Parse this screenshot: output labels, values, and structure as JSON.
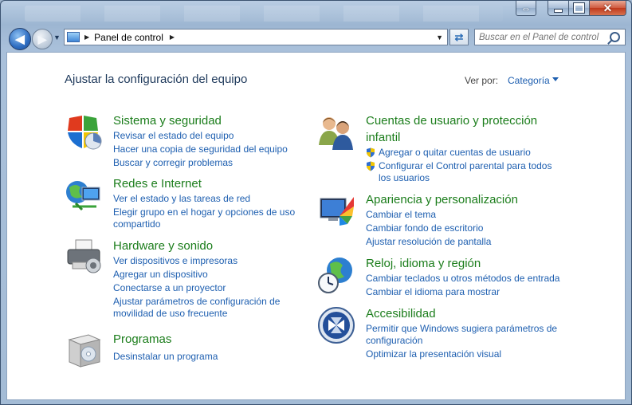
{
  "window": {
    "caption_resize": "⇔",
    "caption_close": "✕"
  },
  "toolbar": {
    "address": "Panel de control",
    "search_placeholder": "Buscar en el Panel de control"
  },
  "content": {
    "title": "Ajustar la configuración del equipo",
    "view_by_label": "Ver por:",
    "view_by_value": "Categoría"
  },
  "categories": {
    "system": {
      "title": "Sistema y seguridad",
      "links": [
        "Revisar el estado del equipo",
        "Hacer una copia de seguridad del equipo",
        "Buscar y corregir problemas"
      ]
    },
    "network": {
      "title": "Redes e Internet",
      "links": [
        "Ver el estado y las tareas de red",
        "Elegir grupo en el hogar y opciones de uso",
        "compartido"
      ]
    },
    "hardware": {
      "title": "Hardware y sonido",
      "links": [
        "Ver dispositivos e impresoras",
        "Agregar un dispositivo",
        "Conectarse a un proyector",
        "Ajustar parámetros de configuración de",
        "movilidad de uso frecuente"
      ]
    },
    "programs": {
      "title": "Programas",
      "links": [
        "Desinstalar un programa"
      ]
    },
    "accounts": {
      "title_line1": "Cuentas de usuario y protección",
      "title_line2": "infantil",
      "links": [
        "Agregar o quitar cuentas de usuario",
        "Configurar el Control parental para todos",
        "los usuarios"
      ]
    },
    "appearance": {
      "title": "Apariencia y personalización",
      "links": [
        "Cambiar el tema",
        "Cambiar fondo de escritorio",
        "Ajustar resolución de pantalla"
      ]
    },
    "clock": {
      "title": "Reloj, idioma y región",
      "links": [
        "Cambiar teclados u otros métodos de entrada",
        "Cambiar el idioma para mostrar"
      ]
    },
    "accessibility": {
      "title": "Accesibilidad",
      "links": [
        "Permitir que Windows sugiera parámetros de",
        "configuración",
        "Optimizar la presentación visual"
      ]
    }
  }
}
